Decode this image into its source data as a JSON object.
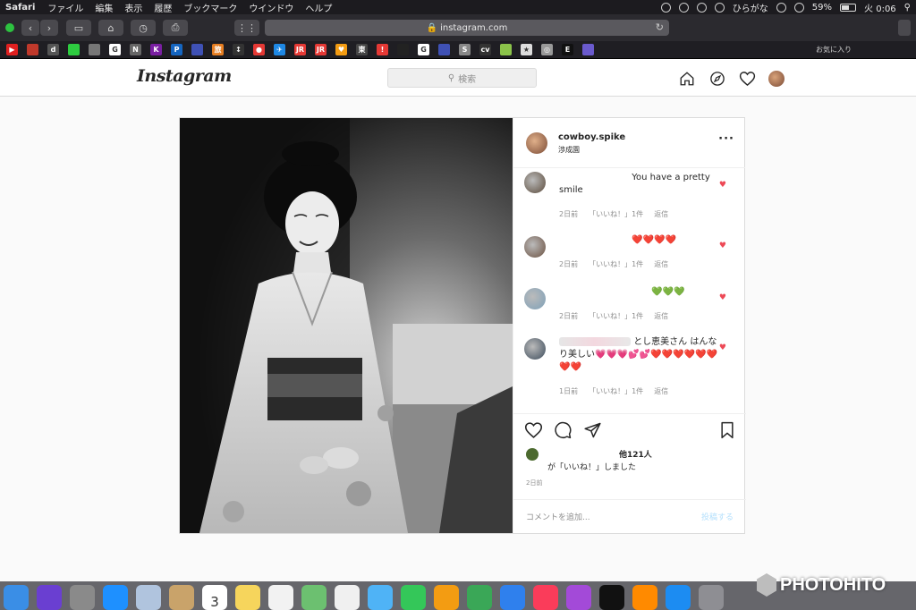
{
  "menubar": {
    "app": "Safari",
    "items": [
      "ファイル",
      "編集",
      "表示",
      "履歴",
      "ブックマーク",
      "ウインドウ",
      "ヘルプ"
    ],
    "input_mode": "ひらがな",
    "battery": "59%",
    "battery_level": 0.59,
    "clock": "火 0:06"
  },
  "browser": {
    "url": "instagram.com",
    "favorites_label": "お気に入り",
    "favorites": [
      {
        "color": "#e02020",
        "glyph": "▶"
      },
      {
        "color": "#c0392b",
        "glyph": ""
      },
      {
        "color": "#555555",
        "glyph": "d"
      },
      {
        "color": "#2ecc40",
        "glyph": ""
      },
      {
        "color": "#777777",
        "glyph": ""
      },
      {
        "color": "#ffffff",
        "glyph": "G"
      },
      {
        "color": "#666666",
        "glyph": "N"
      },
      {
        "color": "#7a1fa2",
        "glyph": "K"
      },
      {
        "color": "#1565c0",
        "glyph": "P"
      },
      {
        "color": "#3f51b5",
        "glyph": ""
      },
      {
        "color": "#e67e22",
        "glyph": "旅"
      },
      {
        "color": "#333333",
        "glyph": "↕"
      },
      {
        "color": "#e53935",
        "glyph": "●"
      },
      {
        "color": "#1e88e5",
        "glyph": "✈"
      },
      {
        "color": "#e53935",
        "glyph": "JR"
      },
      {
        "color": "#e53935",
        "glyph": "JR"
      },
      {
        "color": "#f39c12",
        "glyph": "♥"
      },
      {
        "color": "#444444",
        "glyph": "東"
      },
      {
        "color": "#e53935",
        "glyph": "!"
      },
      {
        "color": "#222222",
        "glyph": ""
      },
      {
        "color": "#ffffff",
        "glyph": "G"
      },
      {
        "color": "#3f51b5",
        "glyph": ""
      },
      {
        "color": "#888888",
        "glyph": "S"
      },
      {
        "color": "#333333",
        "glyph": "cv"
      },
      {
        "color": "#8bc34a",
        "glyph": ""
      },
      {
        "color": "#dddddd",
        "glyph": "★"
      },
      {
        "color": "#999999",
        "glyph": "◎"
      },
      {
        "color": "#111111",
        "glyph": "E"
      },
      {
        "color": "#6a5acd",
        "glyph": ""
      }
    ]
  },
  "instagram": {
    "logo": "Instagram",
    "search_placeholder": "検索",
    "nav_icons": [
      "home-icon",
      "explore-compass-icon",
      "activity-heart-icon",
      "profile-avatar"
    ]
  },
  "post": {
    "username": "cowboy.spike",
    "location": "渉成園",
    "comments": [
      {
        "text": "You have a pretty smile",
        "time": "2日前",
        "likes": "「いいね！」1件",
        "reply": "返信",
        "avatar": "#5a4a3a"
      },
      {
        "text": "❤️❤️❤️❤️",
        "time": "2日前",
        "likes": "「いいね！」1件",
        "reply": "返信",
        "avatar": "#6b5040"
      },
      {
        "text": "💚💚💚",
        "time": "2日前",
        "likes": "「いいね！」1件",
        "reply": "返信",
        "avatar": "#7da0b8"
      },
      {
        "text": "とし恵美さん はんなり美しい💗💗💗💕💕❤️❤️❤️❤️❤️❤️❤️❤️",
        "time": "1日前",
        "likes": "「いいね！」1件",
        "reply": "返信",
        "avatar": "#3b4a5a"
      }
    ],
    "likes_count": "他121人",
    "likes_tail": "が「いいね！」しました",
    "post_time": "2日前",
    "comment_placeholder": "コメントを追加...",
    "post_button": "投稿する"
  },
  "dock": {
    "apps": [
      {
        "name": "finder",
        "color": "#3a8ee6"
      },
      {
        "name": "siri",
        "color": "#6a3fd1"
      },
      {
        "name": "launchpad",
        "color": "#8a8a8a"
      },
      {
        "name": "safari",
        "color": "#1e90ff"
      },
      {
        "name": "preview",
        "color": "#b0c4de"
      },
      {
        "name": "contacts",
        "color": "#c9a36a"
      },
      {
        "name": "calendar",
        "color": "#ffffff"
      },
      {
        "name": "notes",
        "color": "#f6d55c"
      },
      {
        "name": "reminders",
        "color": "#f2f2f2"
      },
      {
        "name": "maps",
        "color": "#6cc070"
      },
      {
        "name": "photos",
        "color": "#f0f0f0"
      },
      {
        "name": "messages",
        "color": "#4fb3f6"
      },
      {
        "name": "facetime",
        "color": "#34c759"
      },
      {
        "name": "pages",
        "color": "#f39c12"
      },
      {
        "name": "numbers",
        "color": "#3aa757"
      },
      {
        "name": "keynote",
        "color": "#2f80ed"
      },
      {
        "name": "music",
        "color": "#fa3c5a"
      },
      {
        "name": "podcasts",
        "color": "#a34ad8"
      },
      {
        "name": "tv",
        "color": "#111111"
      },
      {
        "name": "books",
        "color": "#ff8a00"
      },
      {
        "name": "app-store",
        "color": "#1c8cf2"
      },
      {
        "name": "system-preferences",
        "color": "#8e8e93"
      }
    ],
    "calendar_day": "3"
  },
  "watermark": "PHOTOHITO"
}
